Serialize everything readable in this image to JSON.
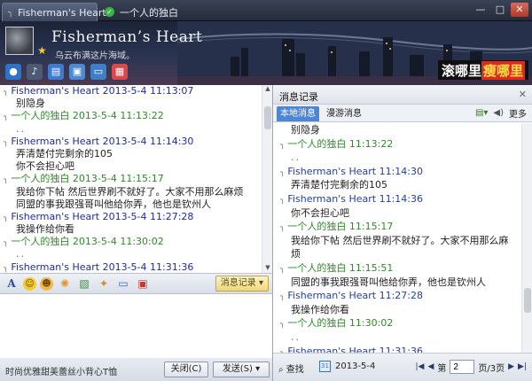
{
  "tabs": [
    {
      "label": "Fisherman's Heart",
      "active": true
    },
    {
      "label": "一个人的独白",
      "active": false
    }
  ],
  "window_buttons": {
    "minimize": "—",
    "maximize": "□",
    "close": "✕"
  },
  "header": {
    "username": "Fisherman’s Heart",
    "motto": "乌云布满这片海域。",
    "banner_white": "滚哪里",
    "banner_red": "瘦哪里"
  },
  "chat": {
    "lines": [
      {
        "kind": "meta",
        "who": "me",
        "text": "Fisherman's Heart 2013-5-4 11:13:07"
      },
      {
        "kind": "msg",
        "text": "别隐身"
      },
      {
        "kind": "meta",
        "who": "peer",
        "text": "一个人的独白 2013-5-4 11:13:22"
      },
      {
        "kind": "dots",
        "text": ".."
      },
      {
        "kind": "meta",
        "who": "me",
        "text": "Fisherman's Heart 2013-5-4 11:14:30"
      },
      {
        "kind": "msg",
        "text": "弄清楚付完剩余的105"
      },
      {
        "kind": "msg",
        "text": "你不会担心吧"
      },
      {
        "kind": "meta",
        "who": "peer",
        "text": "一个人的独白 2013-5-4 11:15:17"
      },
      {
        "kind": "msg",
        "text": "我给你下帖  然后世界刷不就好了。大家不用那么麻烦"
      },
      {
        "kind": "msg",
        "text": "同盟的事我跟强哥叫他给你弄，他也是钦州人"
      },
      {
        "kind": "meta",
        "who": "me",
        "text": "Fisherman's Heart 2013-5-4 11:27:28"
      },
      {
        "kind": "msg",
        "text": "我操作给你看"
      },
      {
        "kind": "meta",
        "who": "peer",
        "text": "一个人的独白 2013-5-4 11:30:02"
      },
      {
        "kind": "dots",
        "text": ".."
      },
      {
        "kind": "meta",
        "who": "me",
        "text": "Fisherman's Heart 2013-5-4 11:31:36"
      }
    ]
  },
  "toolbar": {
    "font_label": "A",
    "history_label": "消息记录"
  },
  "bottom": {
    "ad_text": "时尚优雅甜美蕾丝小背心T恤",
    "close_label": "关闭(C)",
    "send_label": "发送(S)"
  },
  "history": {
    "title": "消息记录",
    "close": "✕",
    "tab_local": "本地消息",
    "tab_roam": "漫游消息",
    "more_label": "更多",
    "lines": [
      {
        "kind": "msg",
        "text": "别隐身"
      },
      {
        "kind": "meta",
        "who": "peer",
        "text": "一个人的独白 11:13:22"
      },
      {
        "kind": "dots",
        "text": ".."
      },
      {
        "kind": "meta",
        "who": "me",
        "text": "Fisherman's Heart 11:14:30"
      },
      {
        "kind": "msg",
        "text": "弄清楚付完剩余的105"
      },
      {
        "kind": "meta",
        "who": "me",
        "text": "Fisherman's Heart 11:14:36"
      },
      {
        "kind": "msg",
        "text": "你不会担心吧"
      },
      {
        "kind": "meta",
        "who": "peer",
        "text": "一个人的独白 11:15:17"
      },
      {
        "kind": "msg",
        "text": "我给你下帖  然后世界刷不就好了。大家不用那么麻"
      },
      {
        "kind": "msg",
        "text": "烦"
      },
      {
        "kind": "meta",
        "who": "peer",
        "text": "一个人的独白 11:15:51"
      },
      {
        "kind": "msg",
        "text": "同盟的事我跟强哥叫他给你弄，他也是钦州人"
      },
      {
        "kind": "meta",
        "who": "me",
        "text": "Fisherman's Heart 11:27:28"
      },
      {
        "kind": "msg",
        "text": "我操作给你看"
      },
      {
        "kind": "meta",
        "who": "peer",
        "text": "一个人的独白 11:30:02"
      },
      {
        "kind": "dots",
        "text": ".."
      },
      {
        "kind": "meta",
        "who": "me",
        "text": "Fisherman's Heart 11:31:36"
      }
    ],
    "footer": {
      "find_label": "查找",
      "date": "2013-5-4",
      "page_prefix": "第",
      "page_value": "2",
      "page_suffix": "页/3页"
    }
  }
}
